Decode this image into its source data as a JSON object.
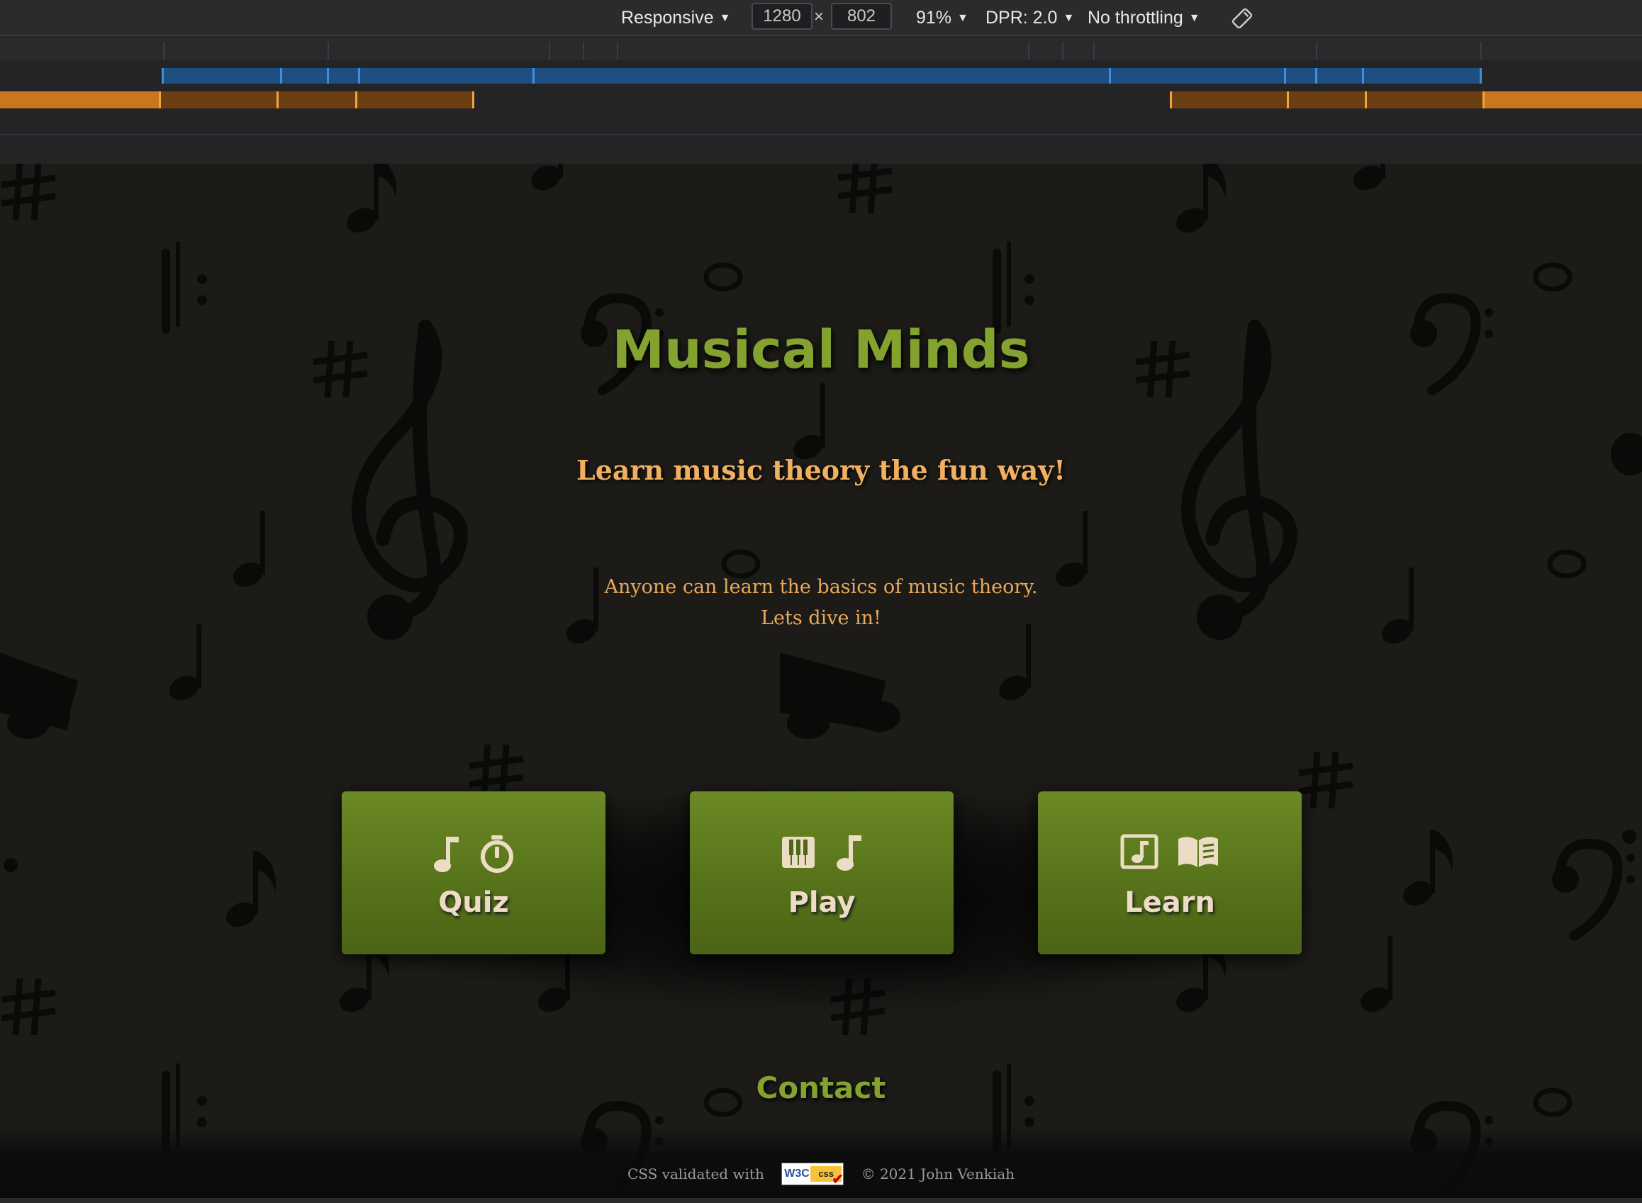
{
  "devtools": {
    "device_mode": "Responsive",
    "width": "1280",
    "height": "802",
    "times_symbol": "×",
    "zoom": "91%",
    "dpr": "DPR: 2.0",
    "throttling": "No throttling",
    "rotate_icon": "rotate-icon"
  },
  "site": {
    "title": "Musical Minds",
    "tagline": "Learn music theory the fun way!",
    "intro_line1": "Anyone can learn the basics of music theory.",
    "intro_line2": "Lets dive in!",
    "cards": [
      {
        "label": "Quiz",
        "icons": [
          "music-note-icon",
          "stopwatch-icon"
        ]
      },
      {
        "label": "Play",
        "icons": [
          "piano-keys-icon",
          "music-note-icon"
        ]
      },
      {
        "label": "Learn",
        "icons": [
          "music-score-icon",
          "book-open-icon"
        ]
      }
    ],
    "contact": "Contact",
    "footer": {
      "validated_text": "CSS validated with",
      "badge_w3c": "W3C",
      "badge_css": "css",
      "copyright": "© 2021 John Venkiah"
    }
  },
  "colors": {
    "accent_green": "#84a22f",
    "card_green": "#57731a",
    "tagline_orange": "#f0b060",
    "background": "#1c1b18"
  }
}
